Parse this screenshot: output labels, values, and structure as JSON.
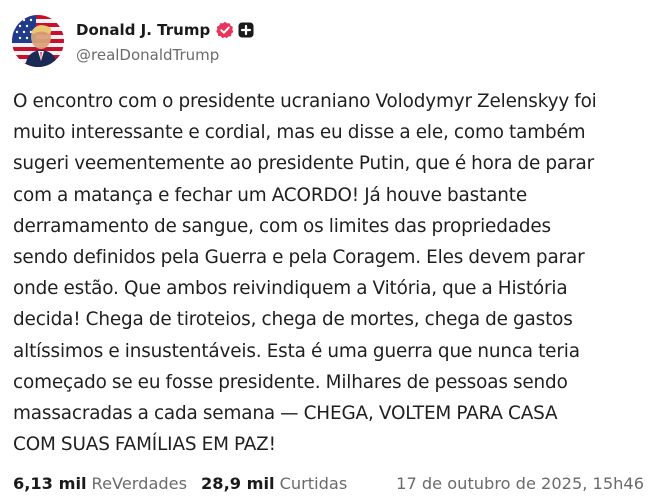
{
  "author": {
    "display_name": "Donald J. Trump",
    "handle": "@realDonaldTrump",
    "verified_icon": "verified-badge-icon",
    "extra_badge_icon": "plus-badge-icon",
    "accent_color": "#e8355c"
  },
  "post": {
    "lines": [
      "O encontro com o presidente ucraniano Volodymyr Zelenskyy foi",
      "muito interessante e cordial, mas eu disse a ele, como também",
      "sugeri veementemente ao presidente Putin, que é hora de parar",
      "com a matança e fechar um ACORDO! Já houve bastante",
      "derramamento de sangue, com os limites das propriedades",
      "sendo definidos pela Guerra e pela Coragem. Eles devem parar",
      "onde estão. Que ambos reivindiquem a Vitória, que a História",
      "decida! Chega de tiroteios, chega de mortes, chega de gastos",
      "altíssimos e insustentáveis. Esta é uma guerra que nunca teria",
      "começado se eu fosse presidente. Milhares de pessoas sendo",
      "massacradas a cada semana — CHEGA, VOLTEM PARA CASA",
      "COM SUAS FAMÍLIAS EM PAZ!"
    ]
  },
  "footer": {
    "reposts_count": "6,13 mil",
    "reposts_label": "ReVerdades",
    "likes_count": "28,9 mil",
    "likes_label": "Curtidas",
    "timestamp": "17 de outubro de 2025, 15h46"
  }
}
